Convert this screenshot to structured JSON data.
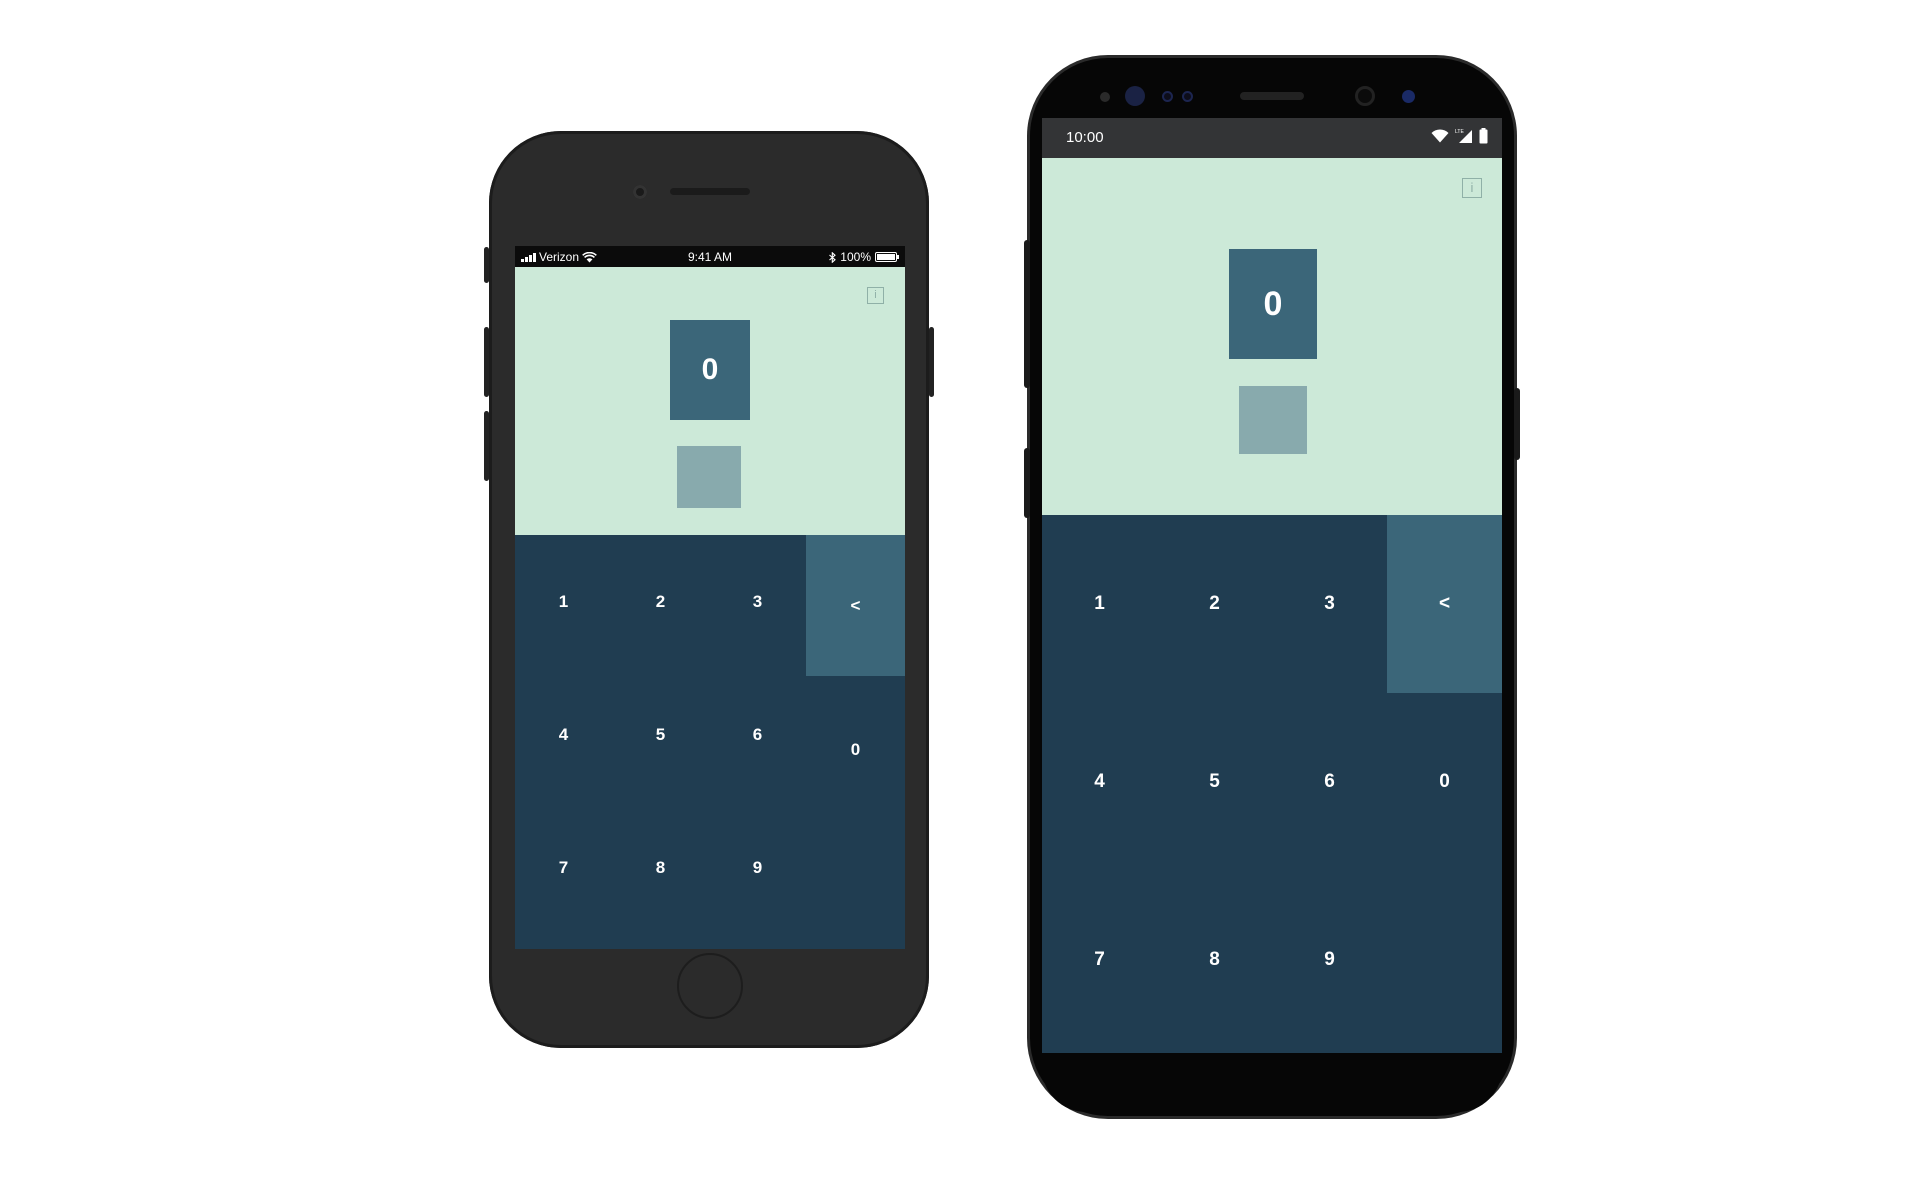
{
  "colors": {
    "panel_light": "#cce9d8",
    "keypad_bg": "#203d51",
    "digit_box": "#3b6679",
    "light_box": "#88aaad",
    "iphone_body": "#2b2b2b",
    "android_body": "#060606"
  },
  "iphone": {
    "status": {
      "carrier": "Verizon",
      "time": "9:41 AM",
      "battery": "100%",
      "battery_level": 1.0
    },
    "display_value": "0",
    "info_icon": "info-icon",
    "keys": {
      "k1": "1",
      "k2": "2",
      "k3": "3",
      "back": "<",
      "k4": "4",
      "k5": "5",
      "k6": "6",
      "k7": "7",
      "k8": "8",
      "k9": "9",
      "k0": "0"
    }
  },
  "android": {
    "status": {
      "time": "10:00",
      "icons": [
        "wifi-icon",
        "lte-signal-icon",
        "battery-icon"
      ]
    },
    "display_value": "0",
    "info_icon": "info-icon",
    "keys": {
      "k1": "1",
      "k2": "2",
      "k3": "3",
      "back": "<",
      "k4": "4",
      "k5": "5",
      "k6": "6",
      "k7": "7",
      "k8": "8",
      "k9": "9",
      "k0": "0"
    }
  }
}
